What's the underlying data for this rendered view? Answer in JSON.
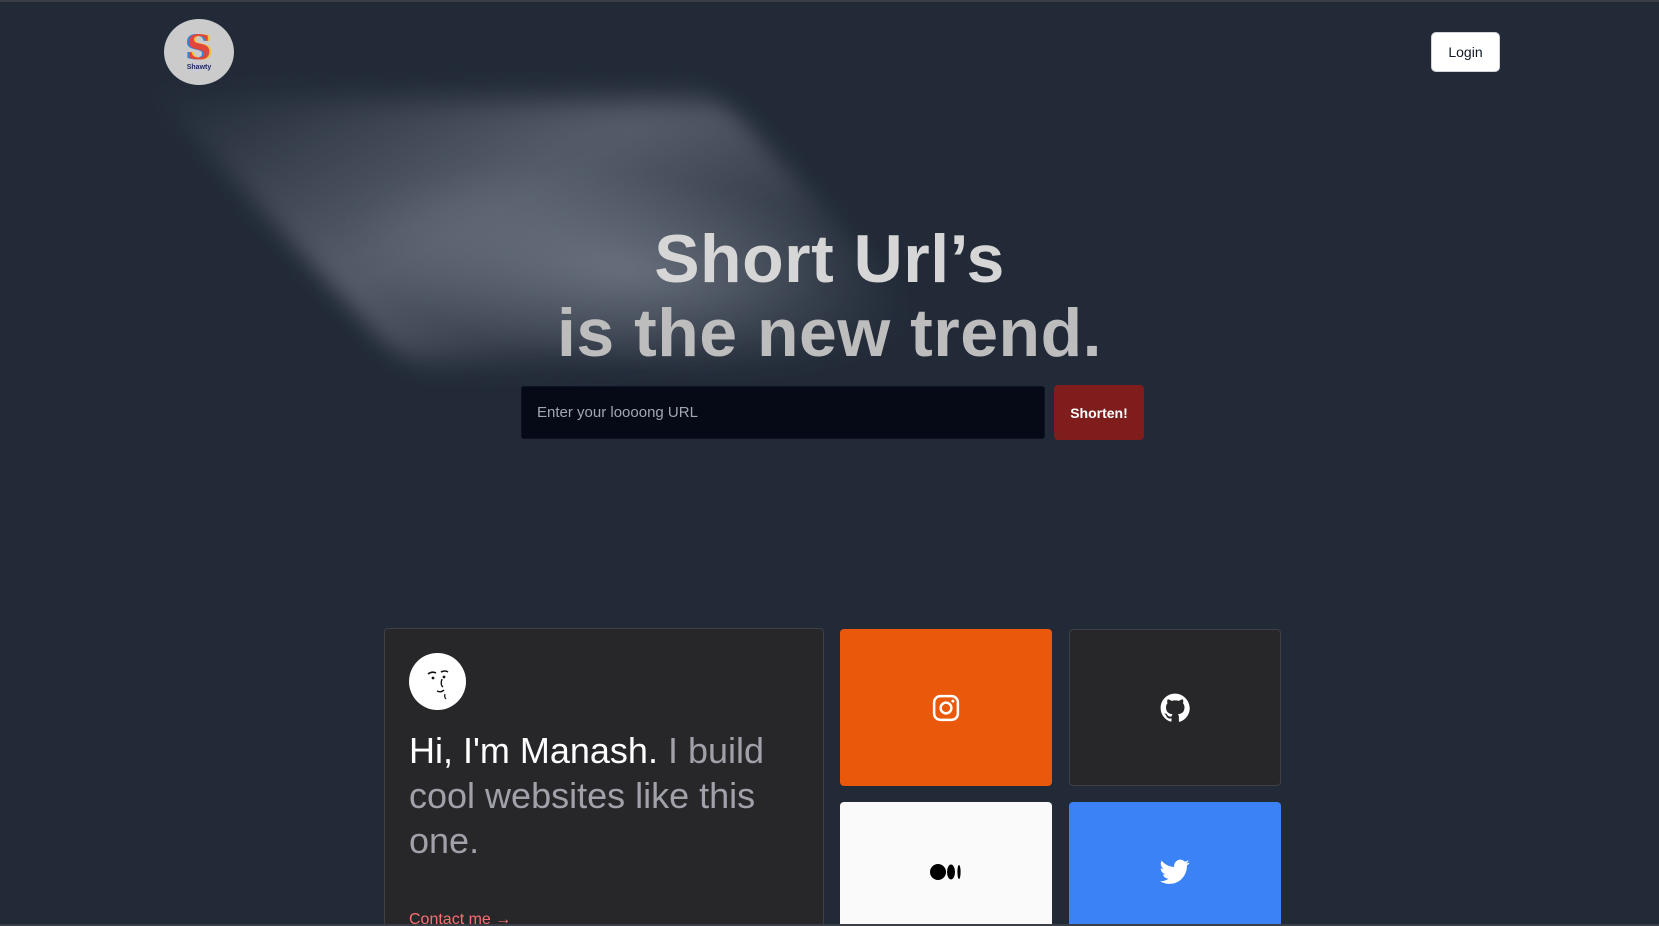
{
  "header": {
    "logo_text": "Shawty",
    "login_label": "Login"
  },
  "hero": {
    "title_line1": "Short Url’s",
    "title_line2": "is the new trend.",
    "input_placeholder": "Enter your loooong URL",
    "input_value": "",
    "shorten_label": "Shorten!"
  },
  "about": {
    "name_text": "Hi, I'm Manash.",
    "tagline": " I build cool websites like this one.",
    "contact_label": "Contact me →"
  },
  "socials": [
    {
      "name": "instagram",
      "icon": "instagram-icon",
      "color": "#ea580c"
    },
    {
      "name": "github",
      "icon": "github-icon",
      "color": "#27272a"
    },
    {
      "name": "medium",
      "icon": "medium-icon",
      "color": "#fafafa"
    },
    {
      "name": "twitter",
      "icon": "twitter-icon",
      "color": "#3b82f6"
    }
  ],
  "colors": {
    "background": "#222a38",
    "accent_button": "#7f1d1d",
    "contact_link": "#f87171"
  }
}
